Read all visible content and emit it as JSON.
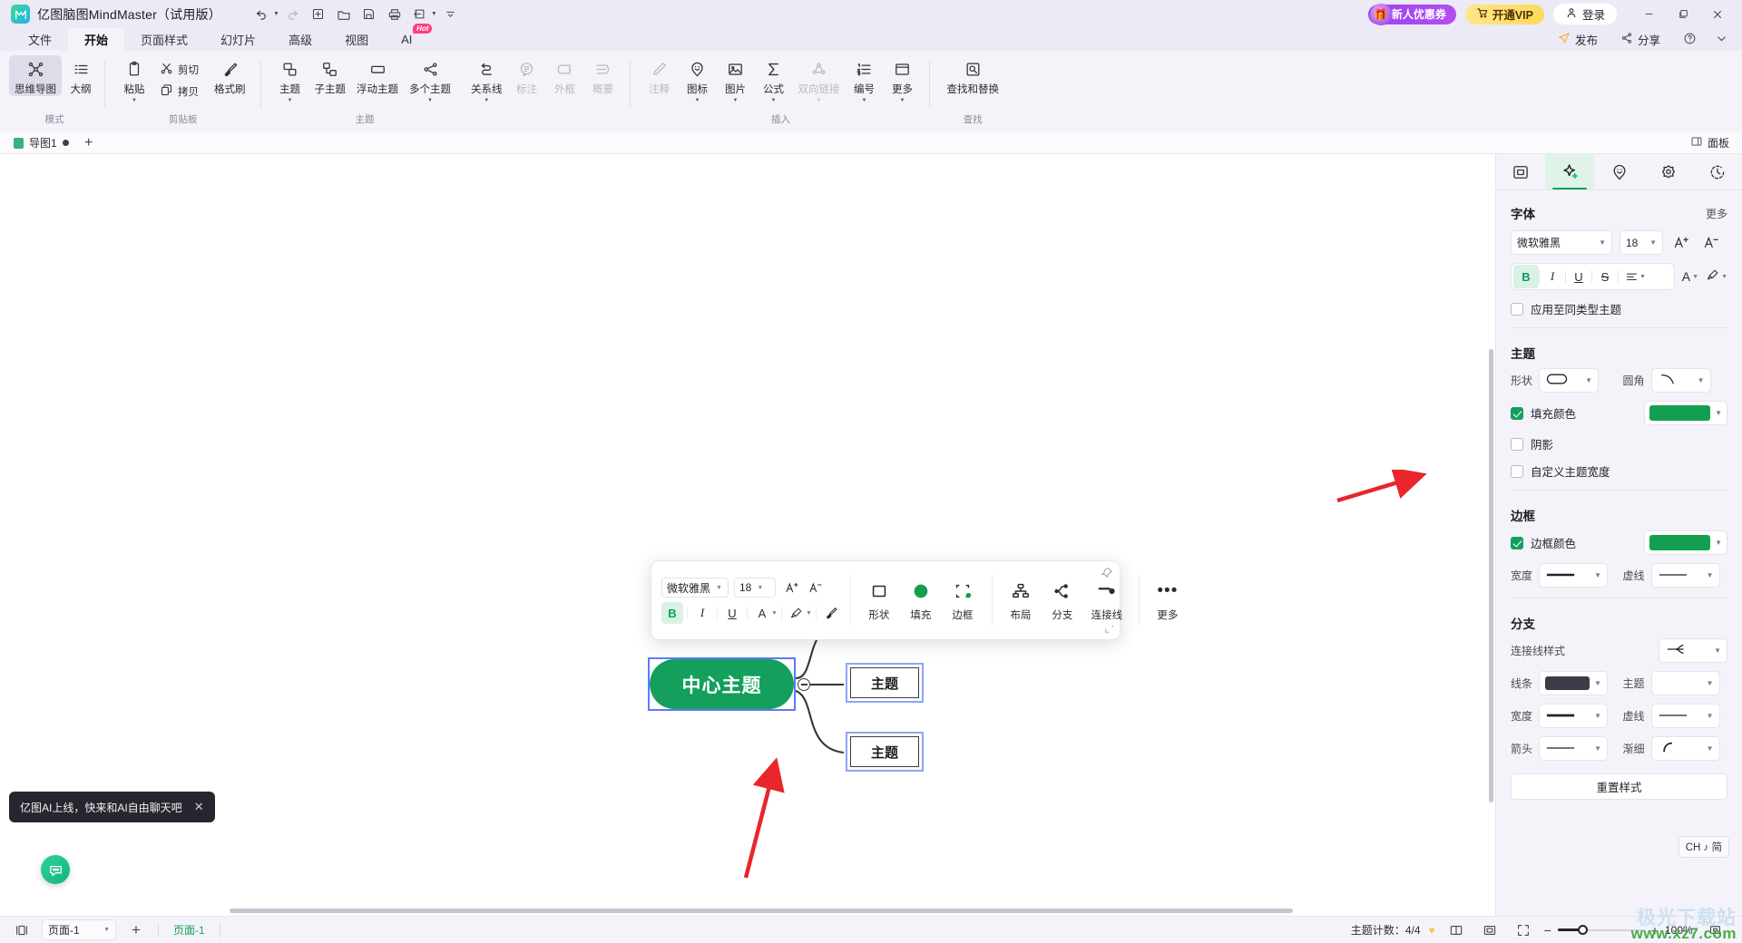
{
  "titlebar": {
    "app_title": "亿图脑图MindMaster（试用版）",
    "logo_icon": "mindmaster-logo-icon",
    "quick_access": [
      {
        "name": "undo-button",
        "icon": "undo-arrow-icon",
        "has_caret": true
      },
      {
        "name": "redo-button",
        "icon": "redo-arrow-icon",
        "has_caret": false
      },
      {
        "name": "new-button",
        "icon": "plus-box-icon",
        "has_caret": false
      },
      {
        "name": "open-button",
        "icon": "folder-open-icon",
        "has_caret": false
      },
      {
        "name": "save-button",
        "icon": "floppy-disk-icon",
        "has_caret": false
      },
      {
        "name": "print-button",
        "icon": "printer-icon",
        "has_caret": false
      },
      {
        "name": "export-button",
        "icon": "share-export-icon",
        "has_caret": true
      },
      {
        "name": "customize-toolbar-button",
        "icon": "chevron-down-bar-icon",
        "has_caret": false
      }
    ],
    "promo_label": "新人优惠券",
    "promo_icon": "gift-icon",
    "vip_label": "开通VIP",
    "vip_icon": "cart-icon",
    "login_label": "登录",
    "login_icon": "user-icon",
    "window_buttons": [
      {
        "name": "minimize-button",
        "glyph": "—"
      },
      {
        "name": "maximize-button",
        "glyph": "❐"
      },
      {
        "name": "close-button",
        "glyph": "✕"
      }
    ],
    "colors": {
      "bar_bg": "#eceaf5",
      "promo": "#9a46f0",
      "vip": "#ffd95e"
    }
  },
  "menu_tabs": [
    {
      "label": "文件",
      "active": false
    },
    {
      "label": "开始",
      "active": true
    },
    {
      "label": "页面样式",
      "active": false
    },
    {
      "label": "幻灯片",
      "active": false
    },
    {
      "label": "高级",
      "active": false
    },
    {
      "label": "视图",
      "active": false
    },
    {
      "label": "AI",
      "active": false,
      "badge": "Hot"
    }
  ],
  "ribbon": {
    "groups": [
      {
        "title": "模式",
        "items": [
          {
            "label": "思维导图",
            "icon": "mindmap-icon",
            "selected": true,
            "disabled": false,
            "dropdown": false
          },
          {
            "label": "大纲",
            "icon": "outline-list-icon",
            "selected": false,
            "disabled": false,
            "dropdown": false
          }
        ]
      },
      {
        "title": "剪贴板",
        "items": [
          {
            "label": "粘贴",
            "icon": "clipboard-icon",
            "selected": false,
            "disabled": false,
            "dropdown": true
          },
          {
            "label": "剪切",
            "icon": "scissors-icon",
            "selected": false,
            "disabled": false,
            "dropdown": false
          },
          {
            "label": "拷贝",
            "icon": "copy-icon",
            "selected": false,
            "disabled": false,
            "dropdown": false
          },
          {
            "label": "格式刷",
            "icon": "format-brush-icon",
            "selected": false,
            "disabled": false,
            "dropdown": false
          }
        ]
      },
      {
        "title": "主题",
        "items": [
          {
            "label": "主题",
            "icon": "topic-icon",
            "selected": false,
            "disabled": false,
            "dropdown": true
          },
          {
            "label": "子主题",
            "icon": "subtopic-icon",
            "selected": false,
            "disabled": false,
            "dropdown": false
          },
          {
            "label": "浮动主题",
            "icon": "floating-topic-icon",
            "selected": false,
            "disabled": false,
            "dropdown": false
          },
          {
            "label": "多个主题",
            "icon": "multi-topic-icon",
            "selected": false,
            "disabled": false,
            "dropdown": true
          },
          {
            "label": "关系线",
            "icon": "relationship-line-icon",
            "selected": false,
            "disabled": false,
            "dropdown": true
          },
          {
            "label": "标注",
            "icon": "callout-icon",
            "selected": false,
            "disabled": true,
            "dropdown": false
          },
          {
            "label": "外框",
            "icon": "boundary-icon",
            "selected": false,
            "disabled": true,
            "dropdown": false
          },
          {
            "label": "概要",
            "icon": "summary-icon",
            "selected": false,
            "disabled": true,
            "dropdown": false
          }
        ]
      },
      {
        "title": "插入",
        "items": [
          {
            "label": "注释",
            "icon": "annotation-pencil-icon",
            "selected": false,
            "disabled": true,
            "dropdown": false
          },
          {
            "label": "图标",
            "icon": "sticker-smiley-icon",
            "selected": false,
            "disabled": false,
            "dropdown": true
          },
          {
            "label": "图片",
            "icon": "picture-icon",
            "selected": false,
            "disabled": false,
            "dropdown": true
          },
          {
            "label": "公式",
            "icon": "sigma-formula-icon",
            "selected": false,
            "disabled": false,
            "dropdown": true
          },
          {
            "label": "双向链接",
            "icon": "bidirectional-link-icon",
            "selected": false,
            "disabled": true,
            "dropdown": true
          },
          {
            "label": "编号",
            "icon": "numbering-icon",
            "selected": false,
            "disabled": false,
            "dropdown": true
          },
          {
            "label": "更多",
            "icon": "more-insert-icon",
            "selected": false,
            "disabled": false,
            "dropdown": true
          }
        ]
      },
      {
        "title": "查找",
        "items": [
          {
            "label": "查找和替换",
            "icon": "search-replace-icon",
            "selected": false,
            "disabled": false,
            "dropdown": false
          }
        ]
      }
    ],
    "right_actions": [
      {
        "label": "发布",
        "icon": "publish-send-icon"
      },
      {
        "label": "分享",
        "icon": "share-nodes-icon"
      },
      {
        "label": "",
        "icon": "help-question-icon"
      },
      {
        "label": "",
        "icon": "collapse-ribbon-icon"
      }
    ]
  },
  "doc_tabbar": {
    "tabs": [
      {
        "label": "导图1",
        "modified": true
      }
    ],
    "add_tab_icon": "plus-icon",
    "panel_toggle_label": "面板",
    "panel_toggle_icon": "panel-toggle-icon"
  },
  "float_toolbar": {
    "font_family": "微软雅黑",
    "font_size": "18",
    "grow_font_icon": "increase-font-icon",
    "shrink_font_icon": "decrease-font-icon",
    "bold": {
      "glyph": "B",
      "active": true
    },
    "italic": {
      "glyph": "I",
      "active": false
    },
    "underline": {
      "glyph": "U",
      "active": false
    },
    "font_color": {
      "glyph": "A",
      "active": false
    },
    "highlight": {
      "glyph": "✎",
      "active": false
    },
    "clear_format_icon": "clear-format-icon",
    "big_buttons": [
      {
        "label": "形状",
        "icon": "shape-square-icon"
      },
      {
        "label": "填充",
        "icon": "fill-circle-icon",
        "color": "#12a050"
      },
      {
        "label": "边框",
        "icon": "border-icon"
      },
      {
        "label": "布局",
        "icon": "layout-tree-icon"
      },
      {
        "label": "分支",
        "icon": "branch-icon"
      },
      {
        "label": "连接线",
        "icon": "connector-line-icon"
      },
      {
        "label": "更多",
        "icon": "ellipsis-icon"
      }
    ],
    "pin_icon": "pin-icon",
    "resize_icon": "resize-handle-icon"
  },
  "mindmap": {
    "center_node": {
      "text": "中心主题",
      "fill": "#14a05c",
      "selected": true
    },
    "topics": [
      {
        "text": "主题",
        "shape": "rounded"
      },
      {
        "text": "主题",
        "shape": "rect"
      },
      {
        "text": "主题",
        "shape": "rect"
      }
    ],
    "collapse_button_icon": "collapse-minus-icon"
  },
  "ai_tip": {
    "message": "亿图AI上线，快来和AI自由聊天吧",
    "close_icon": "close-icon",
    "bubble_icon": "ai-chat-bubble-icon"
  },
  "right_panel": {
    "tabs": [
      {
        "name": "tab-style",
        "icon": "card-style-icon",
        "active": false
      },
      {
        "name": "tab-ai",
        "icon": "sparkle-ai-icon",
        "active": true
      },
      {
        "name": "tab-sticker",
        "icon": "sticker-pin-icon",
        "active": false
      },
      {
        "name": "tab-theme",
        "icon": "flower-theme-icon",
        "active": false
      },
      {
        "name": "tab-history",
        "icon": "clock-history-icon",
        "active": false
      }
    ],
    "font_section": {
      "title": "字体",
      "more_label": "更多",
      "family": "微软雅黑",
      "size": "18",
      "increase_icon": "increase-font-icon",
      "decrease_icon": "decrease-font-icon",
      "bold": {
        "glyph": "B",
        "active": true
      },
      "italic": {
        "glyph": "I",
        "active": false
      },
      "underline": {
        "glyph": "U",
        "active": false
      },
      "strike": {
        "glyph": "S",
        "active": false
      },
      "align_icon": "align-icon",
      "font_color_icon": "font-color-icon",
      "highlight_icon": "highlight-pen-icon",
      "apply_same_type": {
        "label": "应用至同类型主题",
        "checked": false
      }
    },
    "topic_section": {
      "title": "主题",
      "shape_label": "形状",
      "shape_value_icon": "rounded-pill-shape-icon",
      "corner_label": "圆角",
      "corner_value_icon": "corner-arc-icon",
      "fill_color": {
        "label": "填充颜色",
        "checked": true,
        "color": "#12a050"
      },
      "shadow": {
        "label": "阴影",
        "checked": false
      },
      "custom_width": {
        "label": "自定义主题宽度",
        "checked": false
      }
    },
    "border_section": {
      "title": "边框",
      "border_color": {
        "label": "边框颜色",
        "checked": true,
        "color": "#12a050"
      },
      "width_label": "宽度",
      "width_value_icon": "solid-line-icon",
      "dash_label": "虚线",
      "dash_value_icon": "thin-line-icon"
    },
    "branch_section": {
      "title": "分支",
      "connector_style_label": "连接线样式",
      "connector_style_icon": "connector-fan-icon",
      "line_label": "线条",
      "line_color": "#3c3c46",
      "topic_label": "主题",
      "topic_value": "",
      "width_label": "宽度",
      "width_value_icon": "thick-line-icon",
      "dash_label": "虚线",
      "dash_value_icon": "thin-line-icon",
      "arrow_label": "箭头",
      "arrow_value_icon": "plain-line-icon",
      "taper_label": "渐细",
      "taper_value_icon": "taper-arc-icon",
      "reset_label": "重置样式"
    },
    "ime_badge": {
      "text": "CH ♪ 简",
      "icon": "ime-icon"
    }
  },
  "status_bar": {
    "view_toggle_icon": "split-view-icon",
    "page_select": "页面-1",
    "add_page_icon": "plus-icon",
    "current_page": "页面-1",
    "topic_count_label": "主题计数：",
    "topic_count_value": "4/4",
    "count_badge_icon": "heart-badge-icon",
    "layout_icons": [
      {
        "name": "two-page-view-icon"
      },
      {
        "name": "fit-page-icon"
      },
      {
        "name": "fullscreen-icon"
      }
    ],
    "zoom_minus": "−",
    "zoom_plus": "+",
    "zoom_value": "100%",
    "fit_icon": "fit-screen-icon"
  },
  "watermark": {
    "line1": "极光下载站",
    "line2": "www.xz7.com"
  }
}
